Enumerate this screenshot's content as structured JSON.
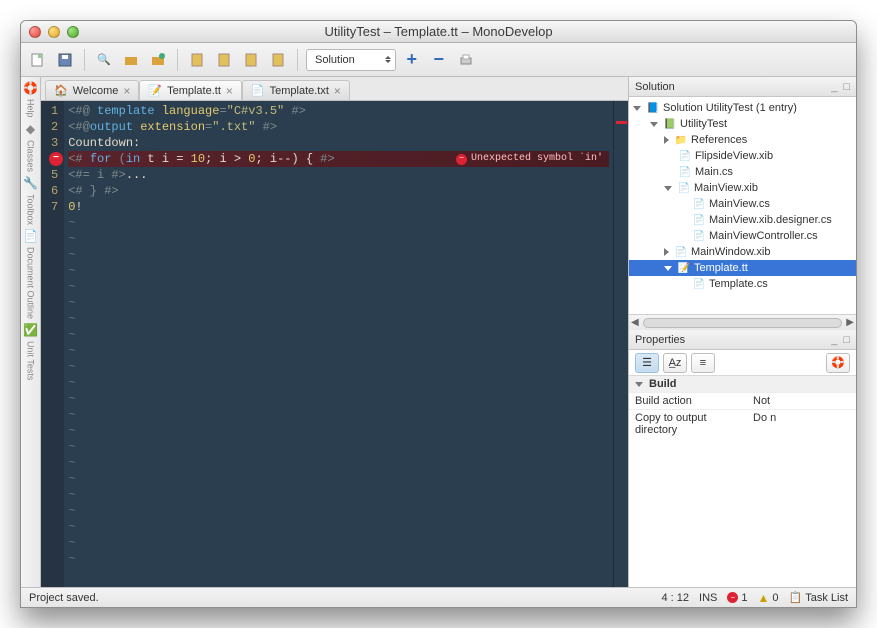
{
  "window": {
    "title": "UtilityTest – Template.tt – MonoDevelop"
  },
  "toolbar": {
    "combo_label": "Solution"
  },
  "siderail": {
    "help": "Help",
    "classes": "Classes",
    "toolbox": "Toolbox",
    "docoutline": "Document Outline",
    "unittests": "Unit Tests"
  },
  "tabs": [
    {
      "label": "Welcome",
      "closable": true
    },
    {
      "label": "Template.tt",
      "closable": true,
      "active": true
    },
    {
      "label": "Template.txt",
      "closable": true
    }
  ],
  "code": {
    "lines": [
      {
        "n": 1,
        "html": "<span class='gray'>&lt;#@ </span><span class='blue'>template</span><span class='gray'> </span><span class='yellow'>language</span><span class='gray'>=</span><span class='str'>\"C#v3.5\"</span><span class='gray'> #&gt;</span>"
      },
      {
        "n": 2,
        "html": "<span class='gray'>&lt;#@</span><span class='blue'>output</span><span class='gray'> </span><span class='yellow'>extension</span><span class='gray'>=</span><span class='str'>\".txt\"</span><span class='gray'> #&gt;</span>"
      },
      {
        "n": 3,
        "html": "<span class='plain'>Countdown:</span>"
      },
      {
        "n": 4,
        "err": true,
        "html": "<span class='gray'>&lt;# </span><span class='blue'>for</span><span class='gray'> (</span><span class='blue'>in</span><span class='plain'> t i = </span><span class='yellow'>10</span><span class='plain'>; i &gt; </span><span class='yellow'>0</span><span class='plain'>; i--) { </span><span class='gray'>#&gt;</span>",
        "errmsg": "Unexpected symbol `in'"
      },
      {
        "n": 5,
        "html": "<span class='gray'>&lt;#= i #&gt;</span><span class='plain'>...</span>"
      },
      {
        "n": 6,
        "html": "<span class='gray'>&lt;# } #&gt;</span>"
      },
      {
        "n": 7,
        "html": "<span class='yellow'>0</span><span class='plain'>!</span>"
      }
    ]
  },
  "solution": {
    "title": "Solution",
    "root": "Solution UtilityTest (1 entry)",
    "project": "UtilityTest",
    "references": "References",
    "items": [
      "FlipsideView.xib",
      "Main.cs"
    ],
    "mainview": "MainView.xib",
    "mainview_children": [
      "MainView.cs",
      "MainView.xib.designer.cs",
      "MainViewController.cs"
    ],
    "mainwindow": "MainWindow.xib",
    "template": "Template.tt",
    "template_child": "Template.cs"
  },
  "properties": {
    "title": "Properties",
    "group": "Build",
    "rows": [
      {
        "k": "Build action",
        "v": "Not"
      },
      {
        "k": "Copy to output directory",
        "v": "Do n"
      }
    ]
  },
  "status": {
    "left": "Project saved.",
    "pos": "4 : 12",
    "mode": "INS",
    "err_count": "1",
    "warn_count": "0",
    "tasks": "Task List"
  }
}
